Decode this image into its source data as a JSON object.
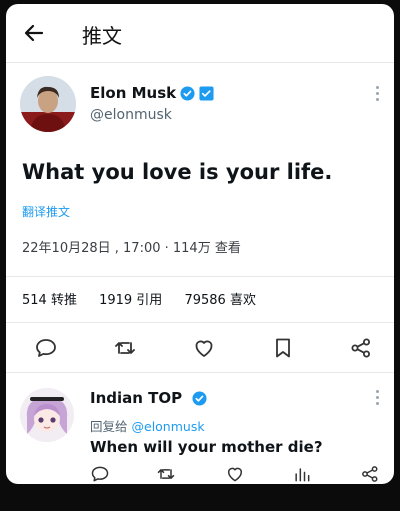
{
  "header": {
    "title": "推文"
  },
  "tweet": {
    "author_name": "Elon Musk",
    "author_handle": "@elonmusk",
    "text": "What you love is your life.",
    "translate_label": "翻译推文",
    "timestamp": "22年10月28日 , 17:00 · 114万 查看",
    "retweets": "514 转推",
    "quotes": "1919 引用",
    "likes": "79586 喜欢"
  },
  "reply_tweet": {
    "author_name": "Indian TOP",
    "replying_prefix": "回复给",
    "replying_to": "@elonmusk",
    "text": "When will your mother die?"
  },
  "colors": {
    "accent": "#1d9bf0",
    "text": "#0f1419",
    "muted": "#536471",
    "background": "#ffffff"
  }
}
